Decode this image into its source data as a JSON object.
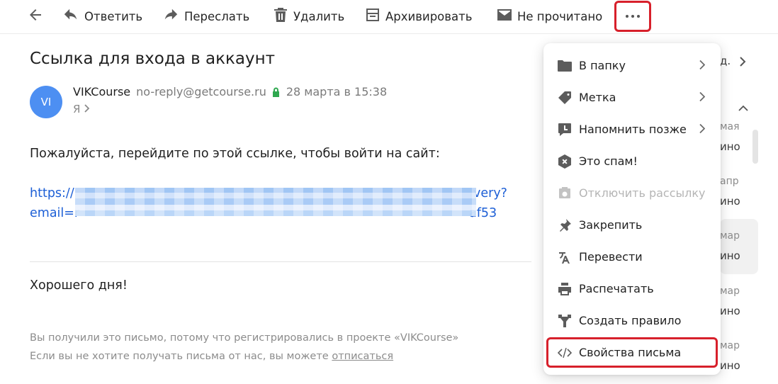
{
  "toolbar": {
    "back_icon": "arrow-left-icon",
    "reply_label": "Ответить",
    "forward_label": "Переслать",
    "delete_label": "Удалить",
    "archive_label": "Архивировать",
    "unread_label": "Не прочитано",
    "more_icon": "more-dots-icon"
  },
  "email": {
    "subject": "Ссылка для входа в аккаунт",
    "avatar_initials": "VI",
    "sender_name": "VIKCourse",
    "sender_email": "no-reply@getcourse.ru",
    "date": "28 марта в 15:38",
    "recipient": "Я",
    "body_line": "Пожалуйста, перейдите по этой ссылке, чтобы войти на сайт:",
    "link_part1_start": "https://",
    "link_part1_end": "very?",
    "link_part2_start": "email=r",
    "link_part2_end": "af53",
    "greeting": "Хорошего дня!",
    "footer_line1": "Вы получили это письмо, потому что регистрировались в проекте «VIKCourse»",
    "footer_line2_prefix": "Если вы не хотите получать письма от нас, вы можете ",
    "footer_unsubscribe": "отписаться"
  },
  "right_list": {
    "top_label": "д.",
    "dates": [
      "мая",
      "апр",
      "мар",
      "мар",
      "мар"
    ],
    "snippets": [
      "ино",
      "ино",
      "ино",
      "ино",
      "ино"
    ]
  },
  "menu": {
    "items": [
      {
        "label": "В папку",
        "icon": "folder-icon",
        "submenu": true,
        "disabled": false
      },
      {
        "label": "Метка",
        "icon": "tag-icon",
        "submenu": true,
        "disabled": false
      },
      {
        "label": "Напомнить позже",
        "icon": "reminder-icon",
        "submenu": true,
        "disabled": false
      },
      {
        "label": "Это спам!",
        "icon": "spam-icon",
        "submenu": false,
        "disabled": false
      },
      {
        "label": "Отключить рассылку",
        "icon": "unsubscribe-icon",
        "submenu": false,
        "disabled": true
      },
      {
        "label": "Закрепить",
        "icon": "pin-icon",
        "submenu": false,
        "disabled": false
      },
      {
        "label": "Перевести",
        "icon": "translate-icon",
        "submenu": false,
        "disabled": false
      },
      {
        "label": "Распечатать",
        "icon": "print-icon",
        "submenu": false,
        "disabled": false
      },
      {
        "label": "Создать правило",
        "icon": "rule-icon",
        "submenu": false,
        "disabled": false
      },
      {
        "label": "Свойства письма",
        "icon": "code-icon",
        "submenu": false,
        "disabled": false
      }
    ]
  },
  "colors": {
    "accent_link": "#1d5fd6",
    "highlight_frame": "#d7202b",
    "avatar_bg": "#4d8ff2",
    "lock_green": "#2fa84f"
  }
}
